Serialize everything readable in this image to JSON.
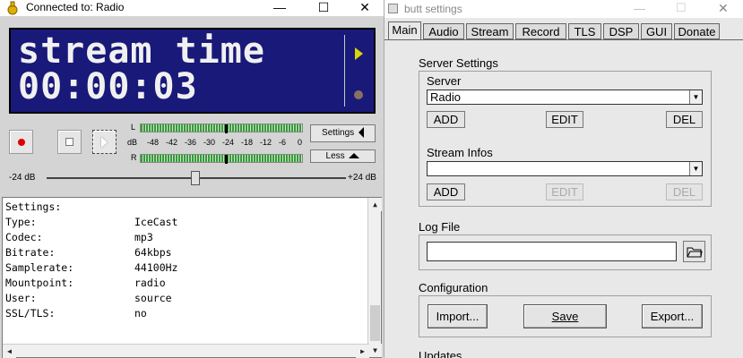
{
  "left_window": {
    "title": "Connected to: Radio",
    "controls": {
      "minimize": "—",
      "maximize": "☐",
      "close": "✕"
    },
    "lcd": {
      "line1": "stream time",
      "line2": "00:00:03"
    },
    "vu": {
      "left_label": "L",
      "right_label": "R",
      "db_label": "dB",
      "scale": [
        "-48",
        "-42",
        "-36",
        "-30",
        "-24",
        "-18",
        "-12",
        "-6",
        "0"
      ]
    },
    "settings_button": "Settings",
    "less_button": "Less",
    "gain": {
      "min_label": "-24 dB",
      "max_label": "+24 dB"
    },
    "info": [
      {
        "key": "Settings:",
        "value": ""
      },
      {
        "key": "Type:",
        "value": "IceCast"
      },
      {
        "key": "Codec:",
        "value": "mp3"
      },
      {
        "key": "Bitrate:",
        "value": "64kbps"
      },
      {
        "key": "Samplerate:",
        "value": "44100Hz"
      },
      {
        "key": "Mountpoint:",
        "value": "radio"
      },
      {
        "key": "User:",
        "value": "source"
      },
      {
        "key": "SSL/TLS:",
        "value": "no"
      }
    ]
  },
  "right_window": {
    "title": "butt settings",
    "tabs": [
      "Main",
      "Audio",
      "Stream",
      "Record",
      "TLS",
      "DSP",
      "GUI",
      "Donate"
    ],
    "active_tab": "Main",
    "server_settings": {
      "heading": "Server Settings",
      "server_label": "Server",
      "server_value": "Radio",
      "stream_infos_label": "Stream Infos",
      "stream_infos_value": "",
      "add": "ADD",
      "edit": "EDIT",
      "del": "DEL"
    },
    "log_file": {
      "heading": "Log File",
      "value": ""
    },
    "configuration": {
      "heading": "Configuration",
      "import": "Import...",
      "save": "Save",
      "export": "Export..."
    },
    "updates": {
      "heading": "Updates"
    }
  }
}
